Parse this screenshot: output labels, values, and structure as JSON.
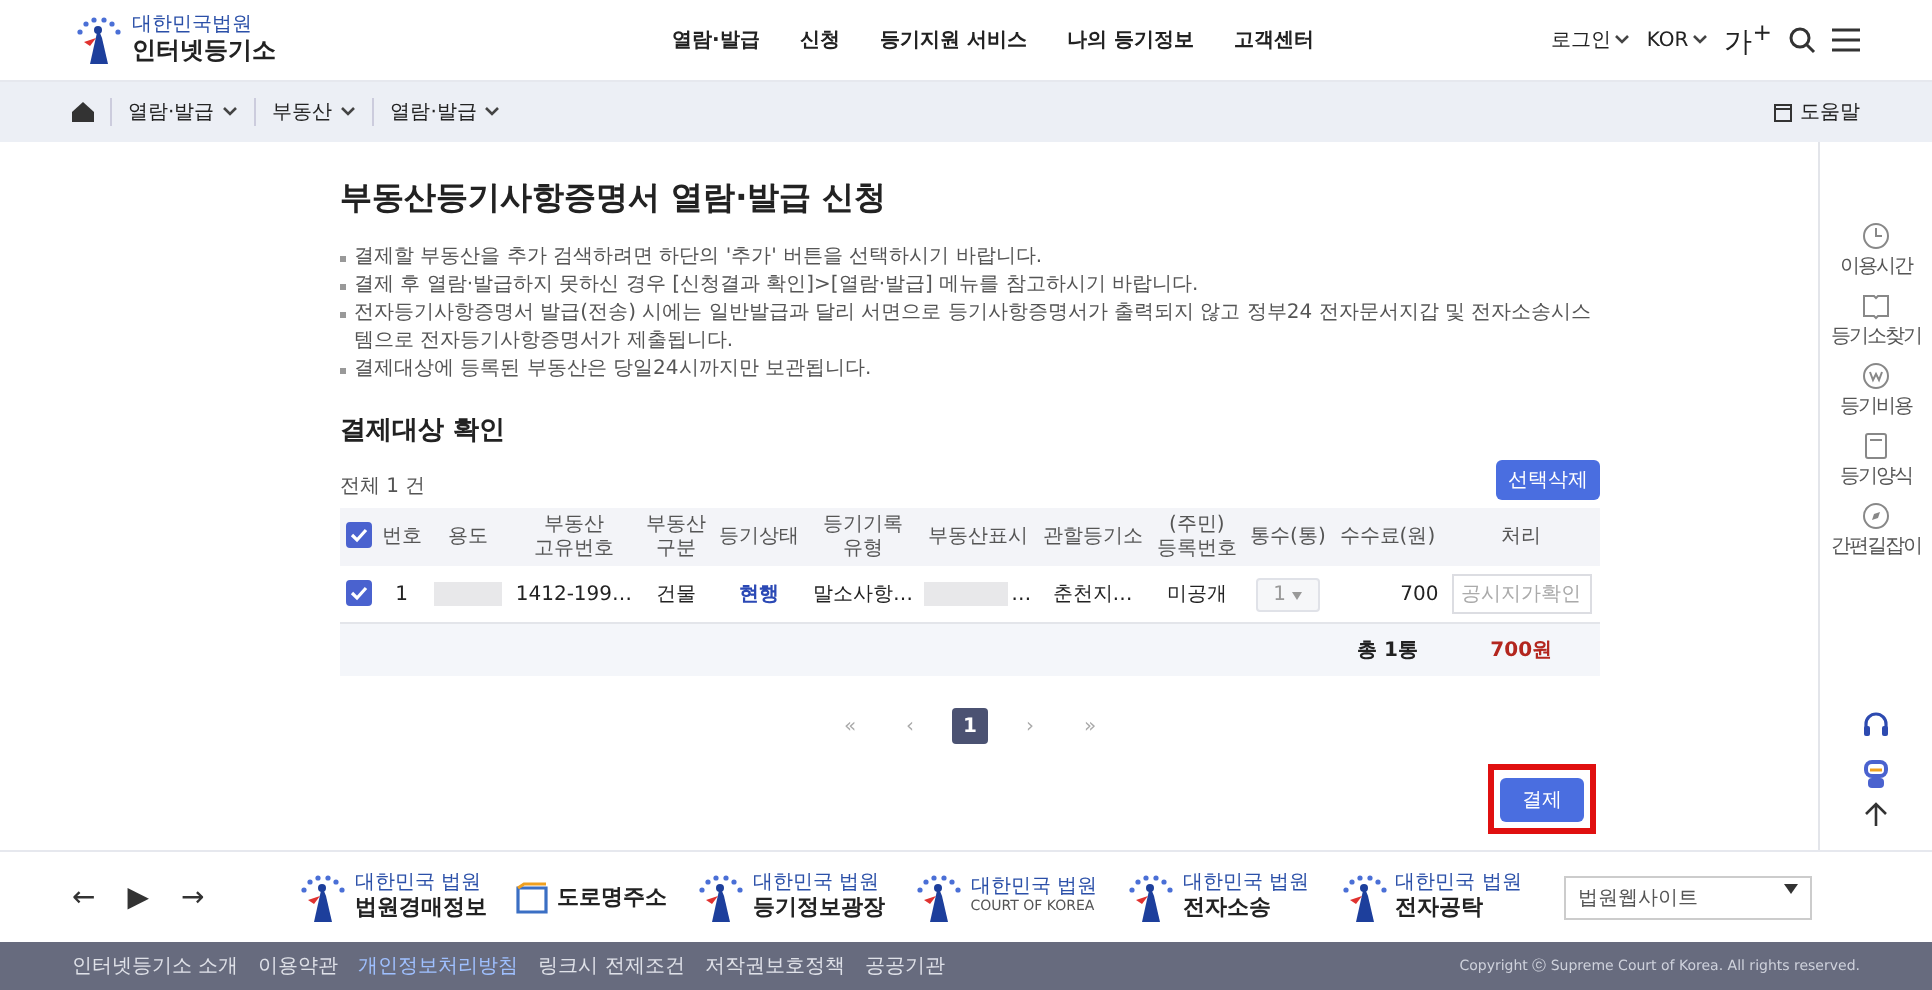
{
  "header": {
    "logo_small": "대한민국법원",
    "logo_title": "인터넷등기소",
    "nav": [
      "열람·발급",
      "신청",
      "등기지원 서비스",
      "나의 등기정보",
      "고객센터"
    ],
    "login": "로그인",
    "language": "KOR",
    "font_size": "가$^{+}$"
  },
  "breadcrumb": {
    "items": [
      "열람·발급",
      "부동산",
      "열람·발급"
    ],
    "help": "도움말"
  },
  "page_title": "부동산등기사항증명서 열람·발급 신청",
  "notices": [
    "결제할 부동산을 추가 검색하려면 하단의 '추가' 버튼을 선택하시기 바랍니다.",
    "결제 후 열람·발급하지 못하신 경우 [신청결과 확인]>[열람·발급] 메뉴를 참고하시기 바랍니다.",
    "전자등기사항증명서 발급(전송) 시에는 일반발급과 달리 서면으로 등기사항증명서가 출력되지 않고 정부24 전자문서지갑 및 전자소송시스템으로 전자등기사항증명서가 제출됩니다.",
    "결제대상에 등록된 부동산은 당일24시까지만 보관됩니다."
  ],
  "section_title": "결제대상 확인",
  "total_count": "전체 1 건",
  "delete_button": "선택삭제",
  "table": {
    "select_all": {
      "checked": true
    },
    "columns": [
      "번호",
      "용도",
      "부동산\n고유번호",
      "부동산\n구분",
      "등기상태",
      "등기기록\n유형",
      "부동산표시",
      "관할등기소",
      "(주민)\n등록번호",
      "통수(통)",
      "수수료(원)",
      "처리"
    ],
    "rows": [
      {
        "checked": true,
        "number": "1",
        "property_id": "1412-199…",
        "category": "건물",
        "status": "현행",
        "record_type": "말소사항…",
        "address_tail": "…",
        "registry": "춘천지…",
        "reg_number": "미공개",
        "copies": "1",
        "copies_disabled": true,
        "fee": "700",
        "action": "공시지가확인",
        "action_disabled": true
      }
    ],
    "total_copies": "총 1통",
    "total_fee": "700원"
  },
  "pagination": [
    {
      "label": "«",
      "selected": false
    },
    {
      "label": "‹",
      "selected": false
    },
    {
      "label": "1",
      "selected": true
    },
    {
      "label": "›",
      "selected": false
    },
    {
      "label": "»",
      "selected": false
    }
  ],
  "pay_button": {
    "label": "결제",
    "highlighted": true
  },
  "quick_menu": [
    "이용시간",
    "등기소찾기",
    "등기비용",
    "등기양식",
    "간편길잡이"
  ],
  "footer": {
    "arrows": [
      "←",
      "▶",
      "→"
    ],
    "sites": [
      {
        "kind": "emblem",
        "small": "대한민국 법원",
        "main": "법원경매정보"
      },
      {
        "kind": "road",
        "main": "도로명주소"
      },
      {
        "kind": "emblem",
        "small": "대한민국 법원",
        "main": "등기정보광장"
      },
      {
        "kind": "court",
        "small": "대한민국 법원",
        "main": "COURT OF KOREA"
      },
      {
        "kind": "emblem",
        "small": "대한민국 법원",
        "main": "전자소송"
      },
      {
        "kind": "emblem",
        "small": "대한민국 법원",
        "main": "전자공탁"
      }
    ],
    "site_select": "법원웹사이트",
    "links": [
      {
        "label": "인터넷등기소 소개",
        "highlighted": false
      },
      {
        "label": "이용약관",
        "highlighted": false
      },
      {
        "label": "개인정보처리방침",
        "highlighted": true
      },
      {
        "label": "링크시 전제조건",
        "highlighted": false
      },
      {
        "label": "저작권보호정책",
        "highlighted": false
      },
      {
        "label": "공공기관",
        "highlighted": false
      }
    ],
    "copyright": "Copyright ⓒ Supreme Court of Korea. All rights reserved."
  }
}
